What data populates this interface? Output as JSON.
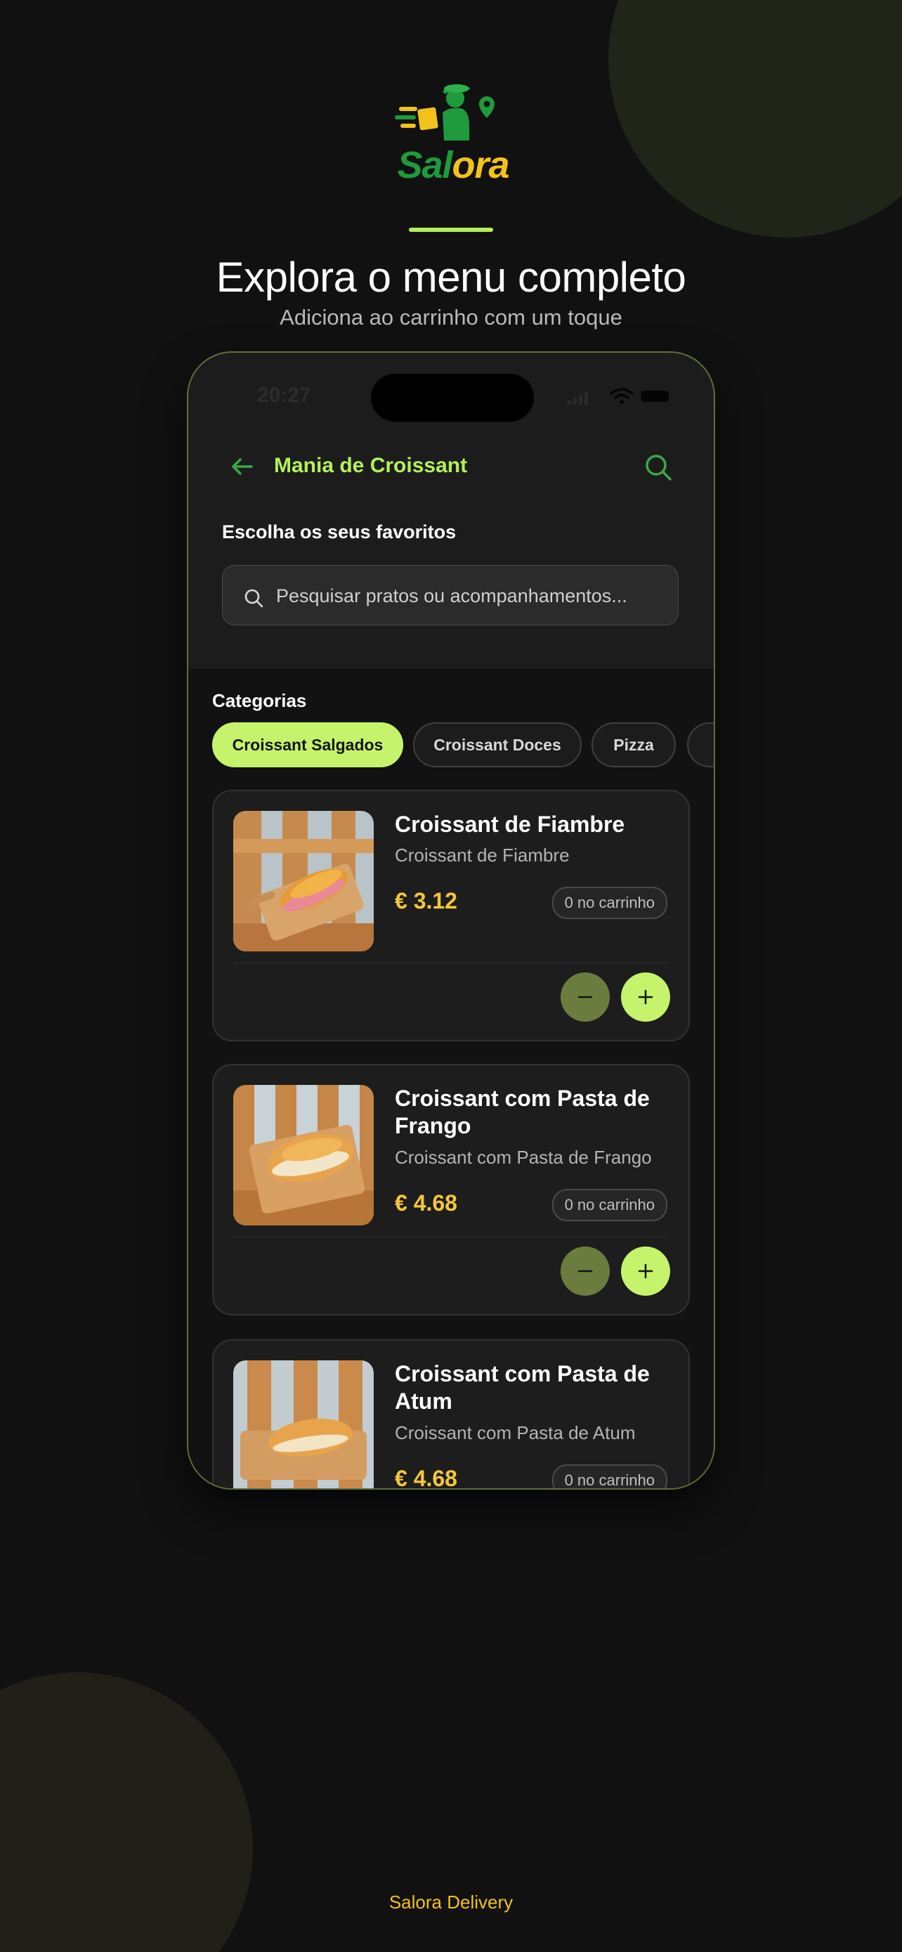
{
  "brand": {
    "logo_text_part1": "Sal",
    "logo_text_part2": "ora",
    "accent_color": "#b4f05a",
    "logo_green": "#1f9a3c",
    "logo_yellow": "#f2c21b"
  },
  "hero": {
    "title": "Explora o menu completo",
    "subtitle": "Adiciona ao carrinho com um toque"
  },
  "status_bar": {
    "time": "20:27"
  },
  "app_bar": {
    "back_icon": "arrow-left-icon",
    "title": "Mania de Croissant",
    "search_icon": "search-icon"
  },
  "favorites": {
    "heading": "Escolha os seus favoritos",
    "search_placeholder": "Pesquisar pratos ou acompanhamentos..."
  },
  "categories": {
    "heading": "Categorias",
    "items": [
      {
        "label": "Croissant Salgados",
        "active": true
      },
      {
        "label": "Croissant Doces",
        "active": false
      },
      {
        "label": "Pizza",
        "active": false
      },
      {
        "label": "",
        "active": false
      }
    ]
  },
  "products": [
    {
      "name": "Croissant de Fiambre",
      "description": "Croissant de Fiambre",
      "price": "€ 3.12",
      "cart_badge": "0 no carrinho"
    },
    {
      "name": "Croissant com Pasta de Frango",
      "description": "Croissant com Pasta de Frango",
      "price": "€ 4.68",
      "cart_badge": "0 no carrinho"
    },
    {
      "name": "Croissant com Pasta de Atum",
      "description": "Croissant com Pasta de Atum",
      "price": "€ 4.68",
      "cart_badge": "0 no carrinho"
    }
  ],
  "footer": {
    "text": "Salora Delivery"
  }
}
